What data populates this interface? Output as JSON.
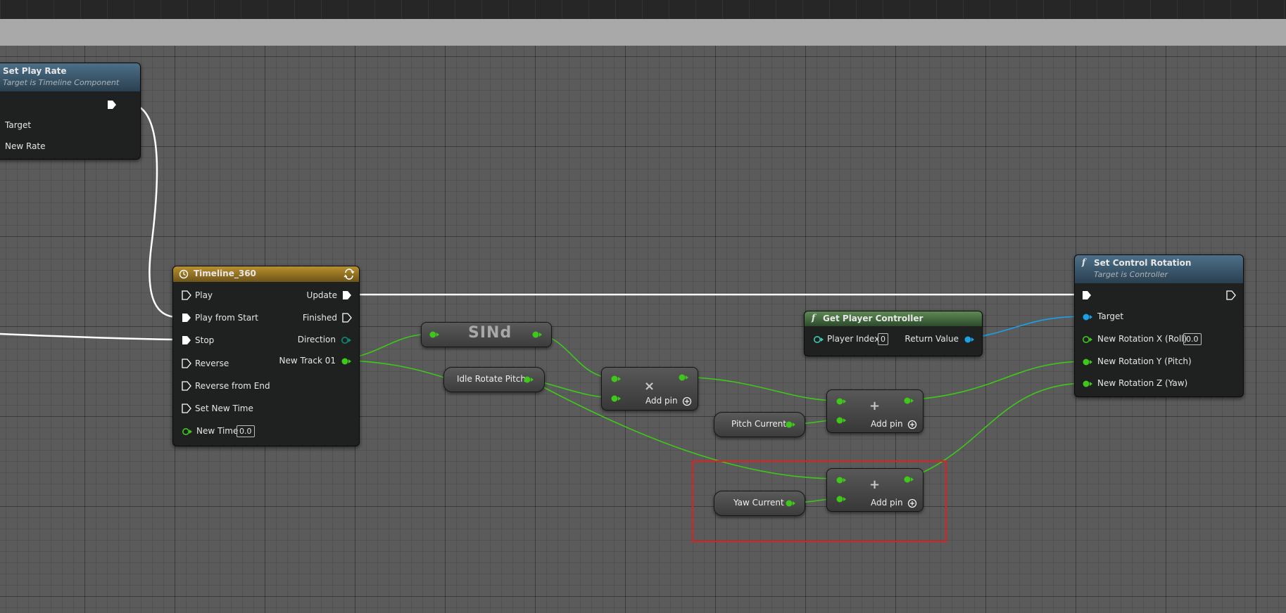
{
  "nodes": {
    "set_play_rate": {
      "title": "Set Play Rate",
      "subtitle": "Target is Timeline Component",
      "pins": {
        "target": "Target",
        "new_rate": "New Rate"
      }
    },
    "timeline": {
      "title": "Timeline_360",
      "pins": {
        "play": "Play",
        "play_from_start": "Play from Start",
        "stop": "Stop",
        "reverse": "Reverse",
        "reverse_from_end": "Reverse from End",
        "set_new_time": "Set New Time",
        "new_time": "New Time",
        "new_time_value": "0.0",
        "update": "Update",
        "finished": "Finished",
        "direction": "Direction",
        "new_track": "New Track 01"
      }
    },
    "sind": {
      "title": "SINd"
    },
    "idle_rotate_pitch": {
      "label": "Idle Rotate Pitch"
    },
    "multiply": {
      "op": "×",
      "add_pin": "Add pin"
    },
    "pitch_current": {
      "label": "Pitch Current"
    },
    "yaw_current": {
      "label": "Yaw Current"
    },
    "add_pitch": {
      "op": "+",
      "add_pin": "Add pin"
    },
    "add_yaw": {
      "op": "+",
      "add_pin": "Add pin"
    },
    "get_player_controller": {
      "title": "Get Player Controller",
      "func_symbol": "f",
      "pins": {
        "player_index": "Player Index",
        "player_index_value": "0",
        "return_value": "Return Value"
      }
    },
    "set_control_rotation": {
      "title": "Set Control Rotation",
      "func_symbol": "f",
      "subtitle": "Target is Controller",
      "pins": {
        "target": "Target",
        "roll": "New Rotation X (Roll)",
        "roll_value": "0.0",
        "pitch": "New Rotation Y (Pitch)",
        "yaw": "New Rotation Z (Yaw)"
      }
    }
  },
  "colors": {
    "float_pin": "#3ec81a",
    "object_pin": "#1aa1e6",
    "exec": "#ffffff",
    "timeline_header": "#a07a1e",
    "function_header": "#3e5f78",
    "pure_header": "#3f6a3a",
    "highlight": "#e02020",
    "direction_pin": "#0e8a78"
  }
}
